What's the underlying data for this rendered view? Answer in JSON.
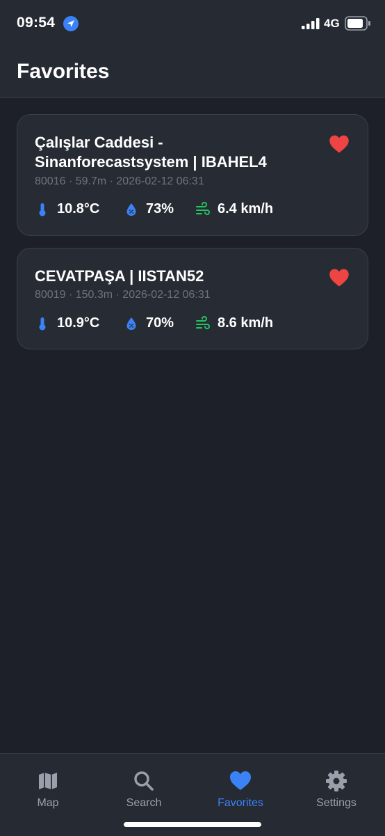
{
  "status_bar": {
    "time": "09:54",
    "network": "4G",
    "icons": [
      "location-arrow-icon",
      "signal-icon",
      "battery-icon"
    ]
  },
  "header": {
    "title": "Favorites"
  },
  "favorites": [
    {
      "name": "Çalışlar Caddesi - Sinanforecastsystem | IBAHEL4",
      "meta": "80016 · 59.7m · 2026-02-12 06:31",
      "temperature": "10.8°C",
      "humidity": "73%",
      "wind": "6.4 km/h"
    },
    {
      "name": "CEVATPAŞA | IISTAN52",
      "meta": "80019 · 150.3m · 2026-02-12 06:31",
      "temperature": "10.9°C",
      "humidity": "70%",
      "wind": "8.6 km/h"
    }
  ],
  "tabs": [
    {
      "label": "Map",
      "icon": "map-icon",
      "active": false
    },
    {
      "label": "Search",
      "icon": "search-icon",
      "active": false
    },
    {
      "label": "Favorites",
      "icon": "heart-icon",
      "active": true
    },
    {
      "label": "Settings",
      "icon": "gear-icon",
      "active": false
    }
  ],
  "colors": {
    "background": "#1d2028",
    "card": "#272b34",
    "accent_blue": "#3b82f6",
    "heart_red": "#ef4444",
    "wind_green": "#22c55e",
    "muted_text": "#6e7380"
  }
}
